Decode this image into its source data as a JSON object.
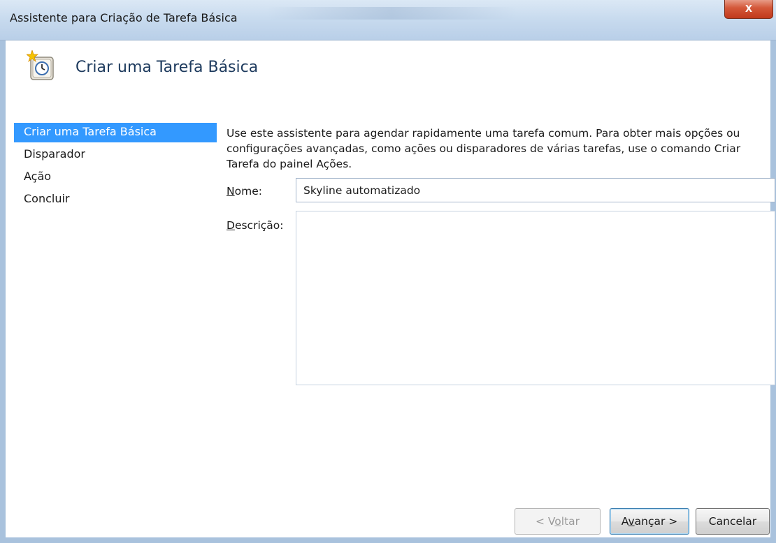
{
  "window": {
    "title": "Assistente para Criação de Tarefa Básica",
    "close_glyph": "x"
  },
  "header": {
    "title": "Criar uma Tarefa Básica",
    "icon": "scheduled-task-clock-icon"
  },
  "nav": {
    "items": [
      {
        "label": "Criar uma Tarefa Básica",
        "selected": true
      },
      {
        "label": "Disparador",
        "selected": false
      },
      {
        "label": "Ação",
        "selected": false
      },
      {
        "label": "Concluir",
        "selected": false
      }
    ]
  },
  "main": {
    "description": "Use este assistente para agendar rapidamente uma tarefa comum. Para obter mais opções ou configurações avançadas, como ações ou disparadores de várias tarefas, use o comando Criar Tarefa do painel Ações.",
    "name_label_accel": "N",
    "name_label_rest": "ome:",
    "name_value": "Skyline automatizado",
    "description_label_accel": "D",
    "description_label_rest": "escrição:",
    "description_value": ""
  },
  "buttons": {
    "back_pre": "< V",
    "back_accel": "o",
    "back_post": "ltar",
    "next_pre": "A",
    "next_accel": "v",
    "next_post": "ançar >",
    "cancel": "Cancelar"
  },
  "colors": {
    "selection": "#3399ff",
    "title_bar": "#c7daee",
    "close_button": "#c0391c",
    "header_title": "#1e3b5e"
  }
}
